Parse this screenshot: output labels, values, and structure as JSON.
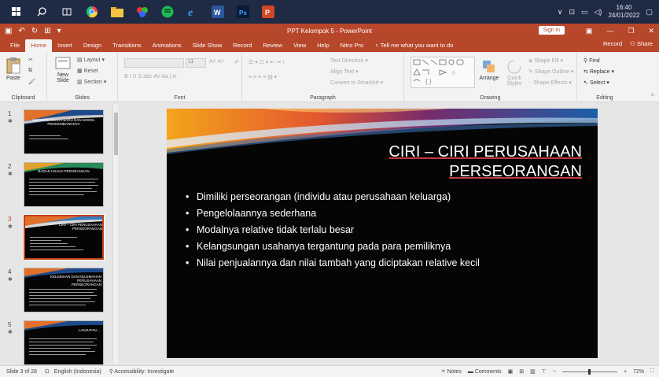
{
  "taskbar": {
    "icons": [
      "windows-icon",
      "search-icon",
      "taskview-icon",
      "chrome-icon",
      "explorer-icon",
      "colors-icon",
      "spotify-icon",
      "edge-icon",
      "word-icon",
      "photoshop-icon",
      "powerpoint-icon"
    ],
    "time": "16:40",
    "date": "24/01/2022"
  },
  "window": {
    "title": "PPT Kelompok 5  -  PowerPoint",
    "signin": "Sign in"
  },
  "tabs": [
    "File",
    "Home",
    "Insert",
    "Design",
    "Transitions",
    "Animations",
    "Slide Show",
    "Record",
    "Review",
    "View",
    "Help",
    "Nitro Pro"
  ],
  "active_tab": "Home",
  "tell_me": "Tell me what you want to do",
  "tab_right": {
    "record": "Record",
    "share": "Share"
  },
  "ribbon": {
    "clipboard": {
      "label": "Clipboard",
      "paste": "Paste"
    },
    "slides": {
      "label": "Slides",
      "new_slide": "New Slide",
      "layout": "Layout",
      "reset": "Reset",
      "section": "Section"
    },
    "font": {
      "label": "Font",
      "size": "11"
    },
    "paragraph": {
      "label": "Paragraph",
      "text_direction": "Text Direction",
      "align_text": "Align Text",
      "smartart": "Convert to SmartArt"
    },
    "drawing": {
      "label": "Drawing",
      "arrange": "Arrange",
      "quick_styles": "Quick Styles",
      "shape_fill": "Shape Fill",
      "shape_outline": "Shape Outline",
      "shape_effects": "Shape Effects"
    },
    "editing": {
      "label": "Editing",
      "find": "Find",
      "replace": "Replace",
      "select": "Select"
    }
  },
  "thumbnails": [
    {
      "num": "1",
      "title": "MERINTIS USAHA BARU DAN MODEL PENGEMBANGNYA"
    },
    {
      "num": "2",
      "title": "BADAN USAHA PERORANGAN"
    },
    {
      "num": "3",
      "title": "CIRI – CIRI PERUSAHAAN PERSEORANGAN"
    },
    {
      "num": "4",
      "title": "KELEBIHAN DAN KELEMAHAN PERUSAHAAN PERSEORANGAN"
    },
    {
      "num": "5",
      "title": "LANJUTAN ...."
    }
  ],
  "selected_thumbnail": "3",
  "slide": {
    "title_line1": "CIRI – CIRI PERUSAHAAN",
    "title_line2": "PERSEORANGAN",
    "bullets": [
      "Dimiliki perseorangan (individu atau perusahaan keluarga)",
      "Pengelolaannya sederhana",
      "Modalnya relative tidak terlalu besar",
      "Kelangsungan usahanya tergantung pada para pemiliknya",
      "Nilai penjualannya dan nilai tambah yang diciptakan relative kecil"
    ]
  },
  "status": {
    "slide_info": "Slide 3 of 28",
    "language": "English (Indonesia)",
    "accessibility": "Accessibility: Investigate",
    "notes": "Notes",
    "comments": "Comments",
    "zoom": "72%"
  },
  "colors": {
    "accent": "#b7472a",
    "slide_bg": "#050505"
  }
}
